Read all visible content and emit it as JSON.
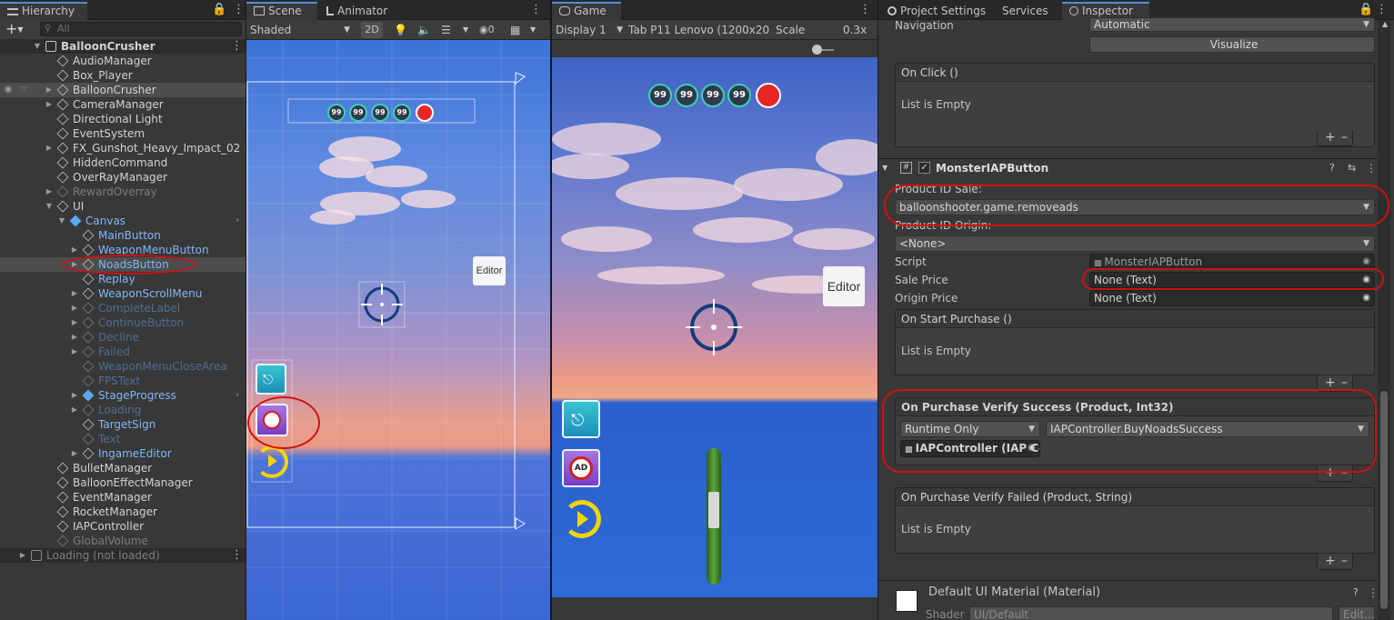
{
  "hierarchy": {
    "tab_label": "Hierarchy",
    "add_label": "+",
    "search_placeholder": "All",
    "scene_name": "BalloonCrusher",
    "items": [
      {
        "label": "AudioManager"
      },
      {
        "label": "Box_Player"
      },
      {
        "label": "BalloonCrusher"
      },
      {
        "label": "CameraManager"
      },
      {
        "label": "Directional Light"
      },
      {
        "label": "EventSystem"
      },
      {
        "label": "FX_Gunshot_Heavy_Impact_02"
      },
      {
        "label": "HiddenCommand"
      },
      {
        "label": "OverRayManager"
      },
      {
        "label": "RewardOverray"
      },
      {
        "label": "UI"
      },
      {
        "label": "Canvas"
      },
      {
        "label": "MainButton"
      },
      {
        "label": "WeaponMenuButton"
      },
      {
        "label": "NoadsButton"
      },
      {
        "label": "Replay"
      },
      {
        "label": "WeaponScrollMenu"
      },
      {
        "label": "CompleteLabel"
      },
      {
        "label": "ContinueButton"
      },
      {
        "label": "Decline"
      },
      {
        "label": "Failed"
      },
      {
        "label": "WeaponMenuCloseArea"
      },
      {
        "label": "FPSText"
      },
      {
        "label": "StageProgress"
      },
      {
        "label": "Loading"
      },
      {
        "label": "TargetSign"
      },
      {
        "label": "Text"
      },
      {
        "label": "IngameEditor"
      },
      {
        "label": "BulletManager"
      },
      {
        "label": "BalloonEffectManager"
      },
      {
        "label": "EventManager"
      },
      {
        "label": "RocketManager"
      },
      {
        "label": "IAPController"
      },
      {
        "label": "GlobalVolume"
      }
    ],
    "loading_scene": "Loading (not loaded)"
  },
  "scene": {
    "tab_label": "Scene",
    "animator_tab_label": "Animator",
    "shading_mode": "Shaded",
    "mode_2d": "2D",
    "hidden_count": "0",
    "editor_label": "Editor",
    "scores": [
      "99",
      "99",
      "99",
      "99"
    ]
  },
  "game": {
    "tab_label": "Game",
    "display": "Display 1",
    "device": "Tab P11 Lenovo (1200x20",
    "scale_label": "Scale",
    "scale_value": "0.3x",
    "editor_label": "Editor",
    "scores": [
      "99",
      "99",
      "99",
      "99"
    ],
    "ad_label": "AD"
  },
  "inspector": {
    "tabs": [
      "Project Settings",
      "Services",
      "Inspector"
    ],
    "navigation_label": "Navigation",
    "navigation_value": "Automatic",
    "visualize_label": "Visualize",
    "onclick_header": "On Click ()",
    "list_empty": "List is Empty",
    "component_name": "MonsterIAPButton",
    "product_id_sale_label": "Product ID Sale:",
    "product_id_sale_value": "balloonshooter.game.removeads",
    "product_id_origin_label": "Product ID Origin:",
    "product_id_origin_value": "<None>",
    "script_label": "Script",
    "script_value": "MonsterIAPButton",
    "sale_price_label": "Sale Price",
    "sale_price_value": "None (Text)",
    "origin_price_label": "Origin Price",
    "origin_price_value": "None (Text)",
    "start_purchase_header": "On Start Purchase ()",
    "verify_success_header": "On Purchase Verify Success (Product, Int32)",
    "runtime_mode": "Runtime Only",
    "function_value": "IAPController.BuyNoadsSuccess",
    "object_value": "IAPController (IAP Co",
    "verify_failed_header": "On Purchase Verify Failed (Product, String)",
    "material_name": "Default UI Material (Material)",
    "shader_label": "Shader",
    "shader_value": "UI/Default",
    "edit_label": "Edit..."
  }
}
